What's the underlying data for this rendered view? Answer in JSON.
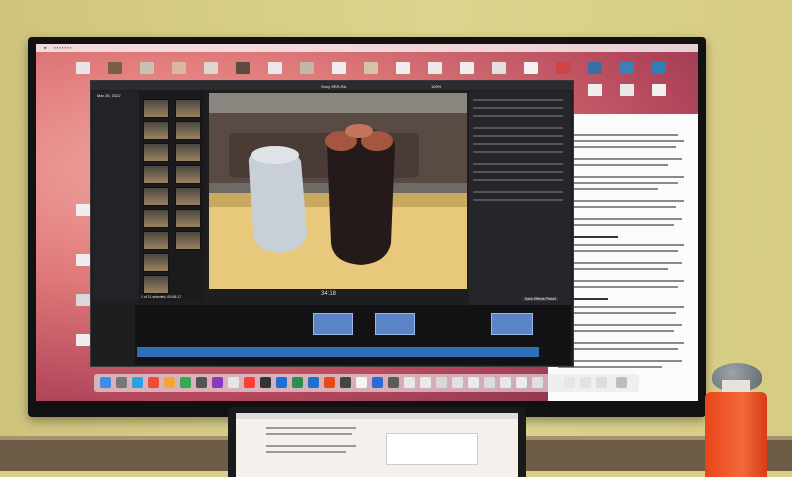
{
  "scene": {
    "fcp": {
      "library_date": "Mar 26, 2022",
      "project_name": "Sony SRS-RA",
      "viewer_zoom": "100%",
      "timecode": "34:18",
      "selection_info": "1 of 11 selected, 00:08:17",
      "inspector_button": "Save Effects Preset"
    }
  }
}
